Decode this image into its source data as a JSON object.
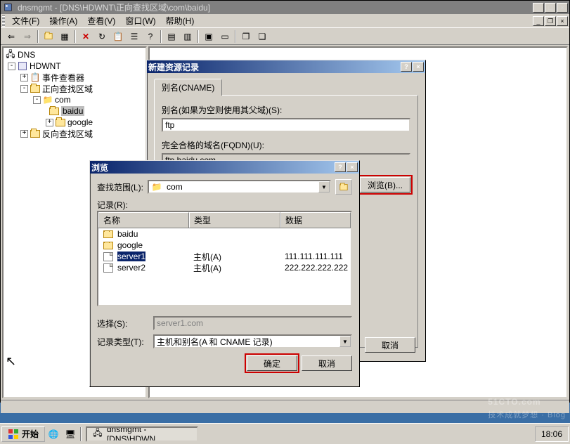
{
  "window": {
    "title": "dnsmgmt - [DNS\\HDWNT\\正向查找区域\\com\\baidu]",
    "title_btn_min": "_",
    "title_btn_max": "□",
    "title_btn_close": "×",
    "child_btn_min": "_",
    "child_btn_max": "❐",
    "child_btn_close": "×"
  },
  "menu": {
    "file": "文件(F)",
    "action": "操作(A)",
    "view": "查看(V)",
    "window": "窗口(W)",
    "help": "帮助(H)"
  },
  "toolbar_icons": [
    "back",
    "fwd",
    "up",
    "list",
    "new",
    "delete",
    "refresh",
    "export",
    "props",
    "help",
    "filter",
    "find",
    "newwin",
    "tile",
    "cascade",
    "copy",
    "paste"
  ],
  "tree": {
    "root": "DNS",
    "server": "HDWNT",
    "event_viewer": "事件查看器",
    "fwd_zone": "正向查找区域",
    "com": "com",
    "baidu": "baidu",
    "google": "google",
    "rev_zone": "反向查找区域"
  },
  "new_rr": {
    "title": "新建资源记录",
    "tab": "别名(CNAME)",
    "alias_label": "别名(如果为空则使用其父域)(S):",
    "alias_value": "ftp",
    "fqdn_label": "完全合格的域名(FQDN)(U):",
    "fqdn_value": "ftp.baidu.com.",
    "browse": "浏览(B)...",
    "cancel": "取消",
    "help_btn": "?",
    "close_btn": "×"
  },
  "browse": {
    "title": "浏览",
    "scope_label": "查找范围(L):",
    "scope_value": "com",
    "records_label": "记录(R):",
    "col_name": "名称",
    "col_type": "类型",
    "col_data": "数据",
    "rows": [
      {
        "name": "baidu",
        "type": "",
        "data": "",
        "icon": "folder"
      },
      {
        "name": "google",
        "type": "",
        "data": "",
        "icon": "folder"
      },
      {
        "name": "server1",
        "type": "主机(A)",
        "data": "111.111.111.111",
        "icon": "file",
        "sel": true
      },
      {
        "name": "server2",
        "type": "主机(A)",
        "data": "222.222.222.222",
        "icon": "file"
      }
    ],
    "select_label": "选择(S):",
    "select_value": "server1.com",
    "rectype_label": "记录类型(T):",
    "rectype_value": "主机和别名(A 和 CNAME 记录)",
    "ok": "确定",
    "cancel": "取消",
    "help_btn": "?",
    "close_btn": "×"
  },
  "taskbar": {
    "start": "开始",
    "task": "dnsmgmt - [DNS\\HDWN...",
    "clock": "18:06"
  },
  "watermark": {
    "main": "51CTO.com",
    "sub": "技术成就梦想 · Blog"
  }
}
